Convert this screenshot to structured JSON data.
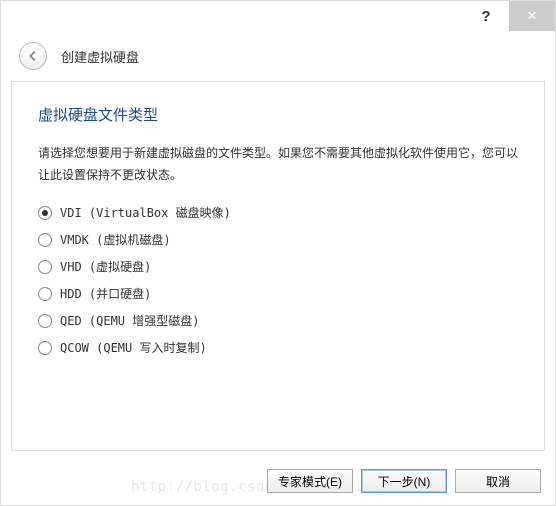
{
  "titlebar": {
    "help": "?",
    "close": "×"
  },
  "header": {
    "title": "创建虚拟硬盘"
  },
  "section": {
    "title": "虚拟硬盘文件类型",
    "description": "请选择您想要用于新建虚拟磁盘的文件类型。如果您不需要其他虚拟化软件使用它，您可以让此设置保持不更改状态。"
  },
  "options": {
    "vdi": "VDI (VirtualBox 磁盘映像)",
    "vmdk": "VMDK (虚拟机磁盘)",
    "vhd": "VHD (虚拟硬盘)",
    "hdd": "HDD (并口硬盘)",
    "qed": "QED (QEMU 增强型磁盘)",
    "qcow": "QCOW (QEMU 写入时复制)"
  },
  "selected": "vdi",
  "footer": {
    "expert": "专家模式(E)",
    "next": "下一步(N)",
    "cancel": "取消"
  },
  "watermark": "http://blog.csdn.net/Kerwin_2017"
}
